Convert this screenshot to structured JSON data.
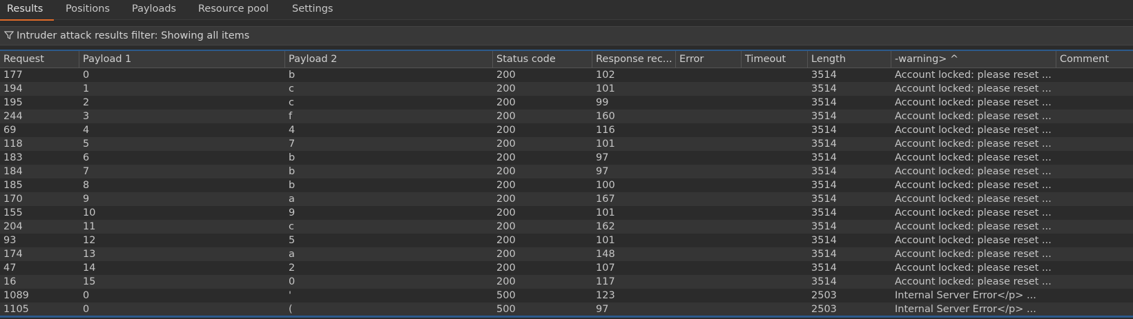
{
  "tabs": [
    {
      "label": "Results",
      "active": true
    },
    {
      "label": "Positions",
      "active": false
    },
    {
      "label": "Payloads",
      "active": false
    },
    {
      "label": "Resource pool",
      "active": false
    },
    {
      "label": "Settings",
      "active": false
    }
  ],
  "filter": {
    "icon": "filter-icon",
    "text": "Intruder attack results filter: Showing all items"
  },
  "colors": {
    "accent_tab": "#e06c2a",
    "accent_line": "#2c5a8c"
  },
  "table": {
    "columns": [
      "Request",
      "Payload 1",
      "Payload 2",
      "Status code",
      "Response rec...",
      "Error",
      "Timeout",
      "Length",
      "-warning> ^",
      "Comment"
    ],
    "rows": [
      [
        "177",
        "0",
        "b",
        "200",
        "102",
        "",
        "",
        "3514",
        "Account locked: please reset ...",
        ""
      ],
      [
        "194",
        "1",
        "c",
        "200",
        "101",
        "",
        "",
        "3514",
        "Account locked: please reset ...",
        ""
      ],
      [
        "195",
        "2",
        "c",
        "200",
        "99",
        "",
        "",
        "3514",
        "Account locked: please reset ...",
        ""
      ],
      [
        "244",
        "3",
        "f",
        "200",
        "160",
        "",
        "",
        "3514",
        "Account locked: please reset ...",
        ""
      ],
      [
        "69",
        "4",
        "4",
        "200",
        "116",
        "",
        "",
        "3514",
        "Account locked: please reset ...",
        ""
      ],
      [
        "118",
        "5",
        "7",
        "200",
        "101",
        "",
        "",
        "3514",
        "Account locked: please reset ...",
        ""
      ],
      [
        "183",
        "6",
        "b",
        "200",
        "97",
        "",
        "",
        "3514",
        "Account locked: please reset ...",
        ""
      ],
      [
        "184",
        "7",
        "b",
        "200",
        "97",
        "",
        "",
        "3514",
        "Account locked: please reset ...",
        ""
      ],
      [
        "185",
        "8",
        "b",
        "200",
        "100",
        "",
        "",
        "3514",
        "Account locked: please reset ...",
        ""
      ],
      [
        "170",
        "9",
        "a",
        "200",
        "167",
        "",
        "",
        "3514",
        "Account locked: please reset ...",
        ""
      ],
      [
        "155",
        "10",
        "9",
        "200",
        "101",
        "",
        "",
        "3514",
        "Account locked: please reset ...",
        ""
      ],
      [
        "204",
        "11",
        "c",
        "200",
        "162",
        "",
        "",
        "3514",
        "Account locked: please reset ...",
        ""
      ],
      [
        "93",
        "12",
        "5",
        "200",
        "101",
        "",
        "",
        "3514",
        "Account locked: please reset ...",
        ""
      ],
      [
        "174",
        "13",
        "a",
        "200",
        "148",
        "",
        "",
        "3514",
        "Account locked: please reset ...",
        ""
      ],
      [
        "47",
        "14",
        "2",
        "200",
        "107",
        "",
        "",
        "3514",
        "Account locked: please reset ...",
        ""
      ],
      [
        "16",
        "15",
        "0",
        "200",
        "117",
        "",
        "",
        "3514",
        "Account locked: please reset ...",
        ""
      ],
      [
        "1089",
        "0",
        "'",
        "500",
        "123",
        "",
        "",
        "2503",
        "Internal Server Error</p>       ...",
        ""
      ],
      [
        "1105",
        "0",
        "(",
        "500",
        "97",
        "",
        "",
        "2503",
        "Internal Server Error</p>       ...",
        ""
      ]
    ]
  }
}
